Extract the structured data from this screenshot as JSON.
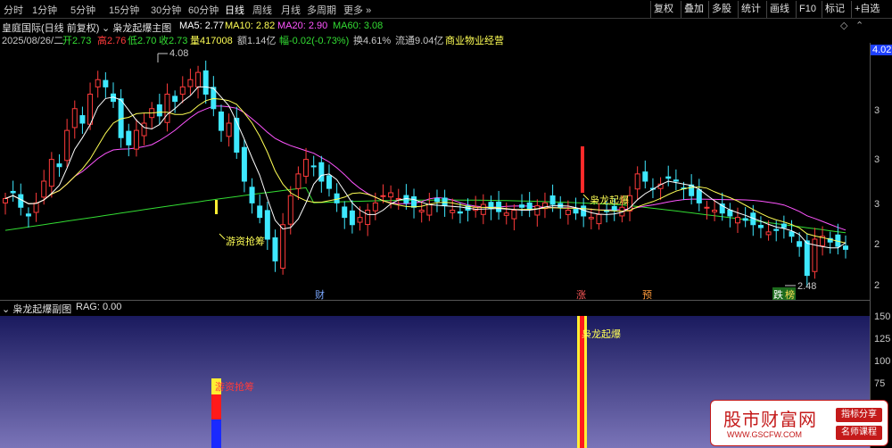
{
  "toolbar": {
    "tabs": [
      "分时",
      "1分钟",
      "5分钟",
      "15分钟",
      "30分钟",
      "60分钟",
      "日线",
      "周线",
      "月线",
      "多周期",
      "更多"
    ],
    "active_tab": "日线",
    "right_buttons": [
      "复权",
      "叠加",
      "多股",
      "统计",
      "画线",
      "F10",
      "标记",
      "+自选"
    ]
  },
  "header": {
    "stock_name": "皇庭国际(日线 前复权)",
    "indicator_name": "枭龙起爆主图",
    "ma5": "MA5: 2.77",
    "ma10": "MA10: 2.82",
    "ma20": "MA20: 2.90",
    "ma60": "MA60: 3.08"
  },
  "quote": {
    "date": "2025/08/26/二",
    "open": "开2.73",
    "high": "高2.76",
    "low": "低2.70",
    "close": "收2.73",
    "volume": "量417008",
    "amount": "额1.14亿",
    "change": "幅-0.02(-0.73%)",
    "turnover": "换4.61%",
    "float": "流通9.04亿",
    "sector": "商业物业经营"
  },
  "main_chart": {
    "annotations": {
      "high_label": "4.08",
      "low_label": "2.48",
      "signal_chase": "游资抢筹",
      "signal_burst": "枭龙起爆"
    },
    "price_tag": "4.02",
    "axis_ticks": [
      "3",
      "3",
      "3",
      "2",
      "2"
    ],
    "event_markers": [
      {
        "label": "财",
        "color": "#7aa7ff"
      },
      {
        "label": "涨",
        "color": "#ff5a5a"
      },
      {
        "label": "预",
        "color": "#ff9a3a"
      },
      {
        "label": "跌",
        "color": "#7cff7c"
      },
      {
        "label": "榜",
        "color": "#ffdd55"
      }
    ],
    "colors": {
      "up": "#ff3b3b",
      "down": "#3ee8ff",
      "ma5": "#ffffff",
      "ma10": "#ffff55",
      "ma20": "#ff55ff",
      "ma60": "#33dd33"
    }
  },
  "sub_chart": {
    "title": "枭龙起爆副图",
    "rag": "RAG: 0.00",
    "signal_chase": "游资抢筹",
    "signal_burst": "枭龙起爆",
    "axis_ticks": [
      "150",
      "125",
      "100",
      "75"
    ]
  },
  "watermark": {
    "title": "股市财富网",
    "url": "WWW.GSCFW.COM",
    "btn1": "指标分享",
    "btn2": "名师课程"
  }
}
